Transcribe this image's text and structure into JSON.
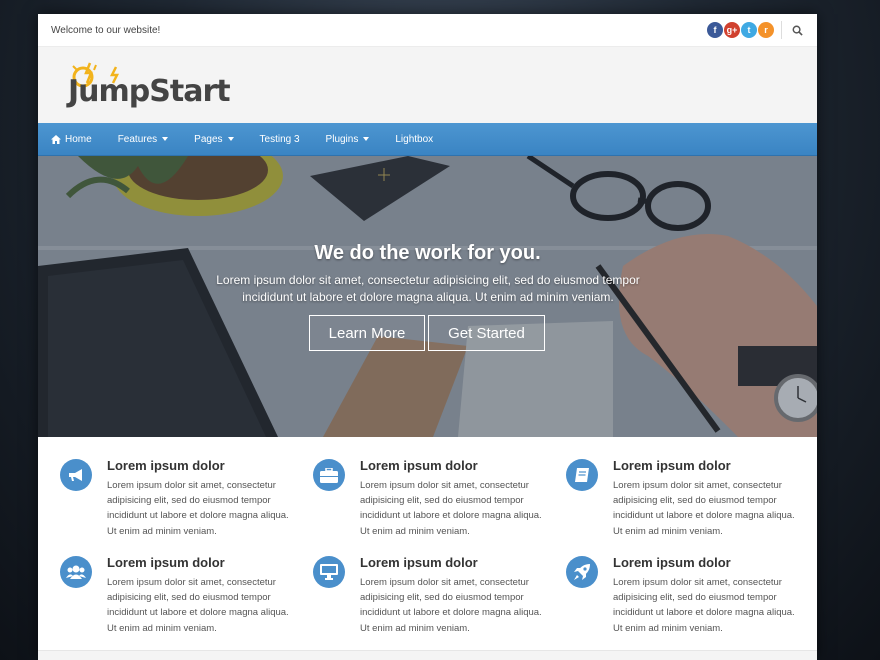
{
  "topbar": {
    "welcome": "Welcome to our website!",
    "social": [
      {
        "name": "facebook-icon",
        "glyph": "f",
        "color": "#3b5998"
      },
      {
        "name": "google-plus-icon",
        "glyph": "g+",
        "color": "#d0412f"
      },
      {
        "name": "twitter-icon",
        "glyph": "t",
        "color": "#3fa9e3"
      },
      {
        "name": "rss-icon",
        "glyph": "r",
        "color": "#f4922a"
      }
    ]
  },
  "header": {
    "logo_text": "JumpStart"
  },
  "nav": {
    "items": [
      {
        "label": "Home",
        "dropdown": false
      },
      {
        "label": "Features",
        "dropdown": true
      },
      {
        "label": "Pages",
        "dropdown": true
      },
      {
        "label": "Testing 3",
        "dropdown": false
      },
      {
        "label": "Plugins",
        "dropdown": true
      },
      {
        "label": "Lightbox",
        "dropdown": false
      }
    ]
  },
  "hero": {
    "title": "We do the work for you.",
    "text": "Lorem ipsum dolor sit amet, consectetur adipisicing elit, sed do eiusmod tempor incididunt ut labore et dolore magna aliqua. Ut enim ad minim veniam.",
    "learn_more": "Learn More",
    "get_started": "Get Started"
  },
  "features": [
    {
      "icon": "megaphone-icon",
      "title": "Lorem ipsum dolor",
      "text": "Lorem ipsum dolor sit amet, consectetur adipisicing elit, sed do eiusmod tempor incididunt ut labore et dolore magna aliqua. Ut enim ad minim veniam."
    },
    {
      "icon": "briefcase-icon",
      "title": "Lorem ipsum dolor",
      "text": "Lorem ipsum dolor sit amet, consectetur adipisicing elit, sed do eiusmod tempor incididunt ut labore et dolore magna aliqua. Ut enim ad minim veniam."
    },
    {
      "icon": "book-icon",
      "title": "Lorem ipsum dolor",
      "text": "Lorem ipsum dolor sit amet, consectetur adipisicing elit, sed do eiusmod tempor incididunt ut labore et dolore magna aliqua. Ut enim ad minim veniam."
    },
    {
      "icon": "users-icon",
      "title": "Lorem ipsum dolor",
      "text": "Lorem ipsum dolor sit amet, consectetur adipisicing elit, sed do eiusmod tempor incididunt ut labore et dolore magna aliqua. Ut enim ad minim veniam."
    },
    {
      "icon": "desktop-icon",
      "title": "Lorem ipsum dolor",
      "text": "Lorem ipsum dolor sit amet, consectetur adipisicing elit, sed do eiusmod tempor incididunt ut labore et dolore magna aliqua. Ut enim ad minim veniam."
    },
    {
      "icon": "rocket-icon",
      "title": "Lorem ipsum dolor",
      "text": "Lorem ipsum dolor sit amet, consectetur adipisicing elit, sed do eiusmod tempor incididunt ut labore et dolore magna aliqua. Ut enim ad minim veniam."
    }
  ],
  "colors": {
    "accent": "#4a8fcb",
    "nav_top": "#4d96d1",
    "nav_bottom": "#3a84c3",
    "logo_bolt": "#f2b31c"
  }
}
